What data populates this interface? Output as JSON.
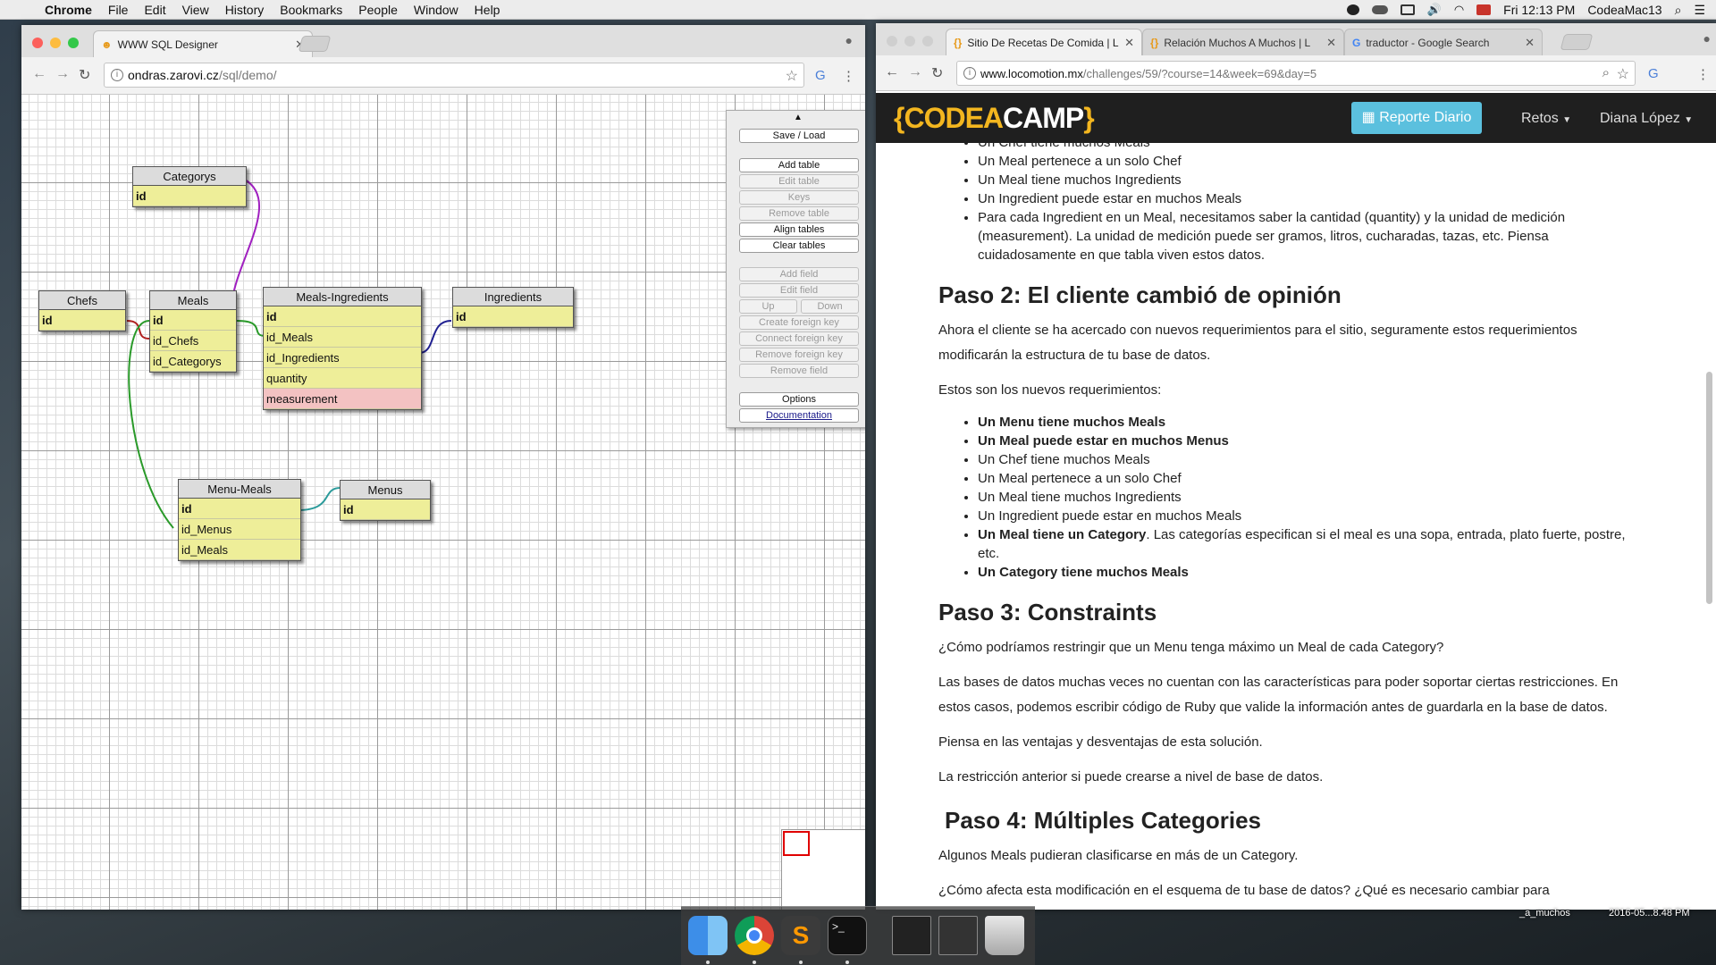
{
  "menubar": {
    "app": "Chrome",
    "items": [
      "File",
      "Edit",
      "View",
      "History",
      "Bookmarks",
      "People",
      "Window",
      "Help"
    ],
    "time": "Fri 12:13 PM",
    "user": "CodeaMac13"
  },
  "left_window": {
    "tab_title": "WWW SQL Designer",
    "url_host": "ondras.zarovi.cz",
    "url_path": "/sql/demo/",
    "panel": {
      "save_load": "Save / Load",
      "add_table": "Add table",
      "edit_table": "Edit table",
      "keys": "Keys",
      "remove_table": "Remove table",
      "align_tables": "Align tables",
      "clear_tables": "Clear tables",
      "add_field": "Add field",
      "edit_field": "Edit field",
      "up": "Up",
      "down": "Down",
      "create_fk": "Create foreign key",
      "connect_fk": "Connect foreign key",
      "remove_fk": "Remove foreign key",
      "remove_field": "Remove field",
      "options": "Options",
      "documentation": "Documentation"
    },
    "tables": {
      "categorys": {
        "name": "Categorys",
        "fields": [
          "id"
        ]
      },
      "chefs": {
        "name": "Chefs",
        "fields": [
          "id"
        ]
      },
      "meals": {
        "name": "Meals",
        "fields": [
          "id",
          "id_Chefs",
          "id_Categorys"
        ]
      },
      "meals_ingredients": {
        "name": "Meals-Ingredients",
        "fields": [
          "id",
          "id_Meals",
          "id_Ingredients",
          "quantity",
          "measurement"
        ]
      },
      "ingredients": {
        "name": "Ingredients",
        "fields": [
          "id"
        ]
      },
      "menu_meals": {
        "name": "Menu-Meals",
        "fields": [
          "id",
          "id_Menus",
          "id_Meals"
        ]
      },
      "menus": {
        "name": "Menus",
        "fields": [
          "id"
        ]
      }
    },
    "relation_colors": {
      "categorys": "#a020c0",
      "chefs": "#b02020",
      "ingredients": "#202090",
      "meals": "#2a9a2a",
      "menus": "#2a9a9a"
    }
  },
  "right_window": {
    "tabs": [
      {
        "title": "Sitio De Recetas De Comida | L",
        "icon": "{}"
      },
      {
        "title": "Relación Muchos A Muchos | L",
        "icon": "{}"
      },
      {
        "title": "traductor - Google Search",
        "icon": "G"
      }
    ],
    "url_host": "www.locomotion.mx",
    "url_path": "/challenges/59/?course=14&week=69&day=5",
    "nav": {
      "logo_open": "{",
      "logo_codea": "CODEA",
      "logo_camp": "CAMP",
      "logo_close": "}",
      "report": "Reporte Diario",
      "retos": "Retos",
      "user": "Diana López"
    },
    "list1": [
      "Un Chef tiene muchos Meals",
      "Un Meal pertenece a un solo Chef",
      "Un Meal tiene muchos Ingredients",
      "Un Ingredient puede estar en muchos Meals",
      "Para cada Ingredient en un Meal, necesitamos saber la cantidad (quantity) y la unidad de medición (measurement). La unidad de medición puede ser gramos, litros, cucharadas, tazas, etc. Piensa cuidadosamente en que tabla viven estos datos."
    ],
    "paso2_title": "Paso 2: El cliente cambió de opinión",
    "paso2_p1": "Ahora el cliente se ha acercado con nuevos requerimientos para el sitio, seguramente estos requerimientos modificarán la estructura de tu base de datos.",
    "paso2_p2": "Estos son los nuevos requerimientos:",
    "list2": {
      "b1": "Un Menu tiene muchos Meals",
      "b2": "Un Meal puede estar en muchos Menus",
      "i3": "Un Chef tiene muchos Meals",
      "i4": "Un Meal pertenece a un solo Chef",
      "i5": "Un Meal tiene muchos Ingredients",
      "i6": "Un Ingredient puede estar en muchos Meals",
      "b7": "Un Meal tiene un Category",
      "t7": ". Las categorías especifican si el meal es una sopa, entrada, plato fuerte, postre, etc.",
      "b8": "Un Category tiene muchos Meals"
    },
    "paso3_title": "Paso 3: Constraints",
    "paso3_p1": "¿Cómo podríamos restringir que un Menu tenga máximo un Meal de cada Category?",
    "paso3_p2": "Las bases de datos muchas veces no cuentan con las características para poder soportar ciertas restricciones. En estos casos, podemos escribir código de Ruby que valide la información antes de guardarla en la base de datos.",
    "paso3_p3": "Piensa en las ventajas y desventajas de esta solución.",
    "paso3_p4": "La restricción anterior si puede crearse a nivel de base de datos.",
    "paso4_title": "Paso 4: Múltiples Categories",
    "paso4_p1": "Algunos Meals pudieran clasificarse en más de un Category.",
    "paso4_p2": "¿Cómo afecta esta modificación en el esquema de tu base de datos? ¿Qué es necesario cambiar para"
  },
  "desktop": {
    "file1": "_a_muchos",
    "file2": "2016-05...8.48 PM"
  }
}
